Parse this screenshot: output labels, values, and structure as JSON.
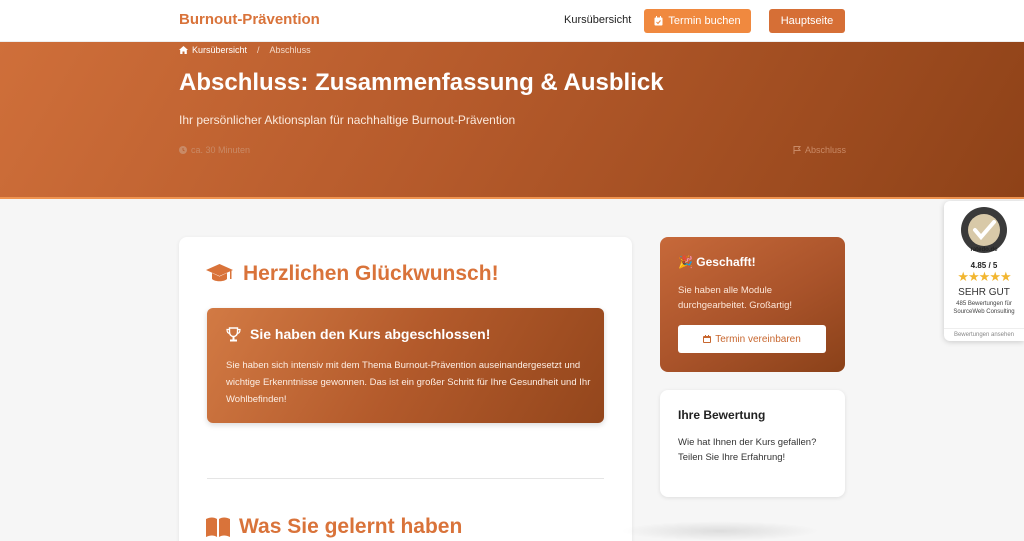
{
  "header": {
    "brand": "Burnout-Prävention",
    "nav_link": "Kursübersicht",
    "termin_button": "Termin buchen",
    "home_button": "Hauptseite",
    "accent": "#f0893f",
    "brand_color": "#d9733a"
  },
  "hero": {
    "breadcrumb": [
      "Kursübersicht",
      "Abschluss"
    ],
    "title": "Abschluss: Zusammenfassung & Ausblick",
    "subtitle": "Ihr persönlicher Aktionsplan für nachhaltige Burnout-Prävention",
    "duration": "ca. 30 Minuten",
    "section": "Abschluss"
  },
  "main": {
    "congrats_title": "Herzlichen Glückwunsch!",
    "done_title": "Sie haben den Kurs abgeschlossen!",
    "done_text": "Sie haben sich intensiv mit dem Thema Burnout-Prävention auseinandergesetzt und wichtige Erkenntnisse gewonnen. Das ist ein großer Schritt für Ihre Gesundheit und Ihr Wohlbefinden!",
    "learned_title": "Was Sie gelernt haben"
  },
  "sidebar": {
    "done_title": "🎉 Geschafft!",
    "done_text": "Sie haben alle Module durchgearbeitet. Großartig!",
    "done_button": "Termin vereinbaren",
    "rating_title": "Ihre Bewertung",
    "rating_text": "Wie hat Ihnen der Kurs gefallen? Teilen Sie Ihre Erfahrung!"
  },
  "rating_widget": {
    "seal_label": "ratedo.de",
    "score": "4.85 / 5",
    "stars": "★★★★★",
    "verdict": "SEHR GUT",
    "count": "485 Bewertungen für SourceWeb Consulting",
    "link": "Bewertungen ansehen"
  }
}
